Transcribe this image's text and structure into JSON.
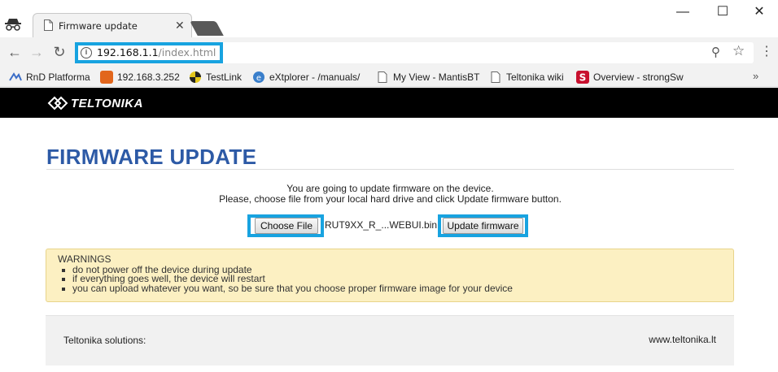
{
  "browser": {
    "tab_title": "Firmware update",
    "url_host": "192.168.1.1",
    "url_path": "/index.html",
    "window_controls": [
      "—",
      "☐",
      "✕"
    ],
    "bookmarks": [
      {
        "label": "RnD Platforma",
        "icon": "rnd-bookmark-icon",
        "color": "#3b6dc7"
      },
      {
        "label": "192.168.3.252",
        "icon": "router-bookmark-icon",
        "color": "#e2661c"
      },
      {
        "label": "TestLink",
        "icon": "testlink-bookmark-icon",
        "color": "#e3c61b"
      },
      {
        "label": "eXtplorer - /manuals/",
        "icon": "extplorer-bookmark-icon",
        "color": "#3a7fcb"
      },
      {
        "label": "My View - MantisBT",
        "icon": "page-bookmark-icon",
        "color": "#ffffff"
      },
      {
        "label": "Teltonika wiki",
        "icon": "page-bookmark-icon",
        "color": "#ffffff"
      },
      {
        "label": "Overview - strongSw",
        "icon": "strongswan-bookmark-icon",
        "color": "#c8102e"
      }
    ],
    "more_bookmarks": "»"
  },
  "brand": {
    "logo_text": "TELTONIKA"
  },
  "page": {
    "title": "FIRMWARE UPDATE",
    "intro_line1": "You are going to update firmware on the device.",
    "intro_line2": "Please, choose file from your local hard drive and click Update firmware button.",
    "choose_file_label": "Choose File",
    "file_name": "RUT9XX_R_...WEBUI.bin",
    "update_button_label": "Update firmware",
    "warnings_title": "WARNINGS",
    "warnings": [
      "do not power off the device during update",
      "if everything goes well, the device will restart",
      "you can upload whatever you want, so be sure that you choose proper firmware image for your device"
    ]
  },
  "footer": {
    "left_text": "Teltonika solutions:",
    "right_text": "www.teltonika.lt"
  },
  "colors": {
    "highlight": "#18a3e0",
    "title": "#2d5aa6",
    "warning_bg": "#fcf0c2"
  }
}
